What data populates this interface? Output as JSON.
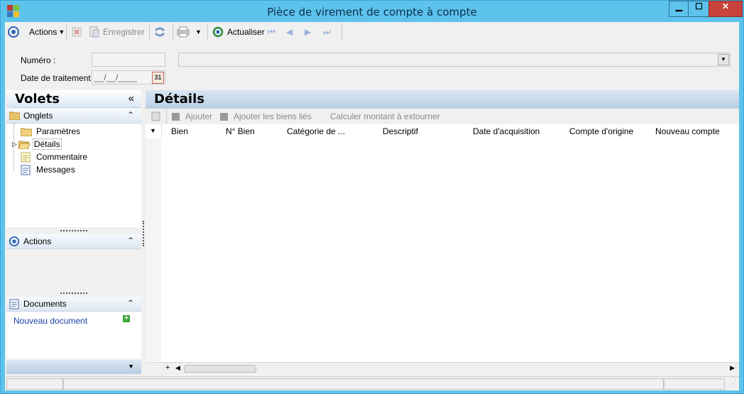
{
  "window": {
    "title": "Pièce de virement de compte à compte",
    "min_glyph": "▁",
    "max_glyph": "☐",
    "close_glyph": "✕"
  },
  "toolbar": {
    "actions_label": "Actions",
    "save_label": "Enregistrer",
    "refresh_label": "Actualiser"
  },
  "form": {
    "numero_label": "Numéro :",
    "date_label": "Date de traitement :",
    "date_placeholder": "__/__/____",
    "calendar_label": "31"
  },
  "left_panel": {
    "title": "Volets",
    "collapse_glyph": "«",
    "onglets": {
      "title": "Onglets",
      "items": [
        "Paramètres",
        "Détails",
        "Commentaire",
        "Messages"
      ]
    },
    "actions": {
      "title": "Actions"
    },
    "documents": {
      "title": "Documents",
      "new_document": "Nouveau document"
    }
  },
  "details": {
    "title": "Détails",
    "add_label": "Ajouter",
    "add_linked_label": "Ajouter les biens liés",
    "calc_label": "Calculer montant à extourner",
    "columns": [
      "Bien",
      "N° Bien",
      "Catégorie de ...",
      "Descriptif",
      "Date d'acquisition",
      "Compte d'origine",
      "Nouveau compte"
    ]
  },
  "colors": {
    "title_bar": "#5dc2ec",
    "close_button": "#c7433b",
    "accent_blue": "#1a3ea8"
  }
}
